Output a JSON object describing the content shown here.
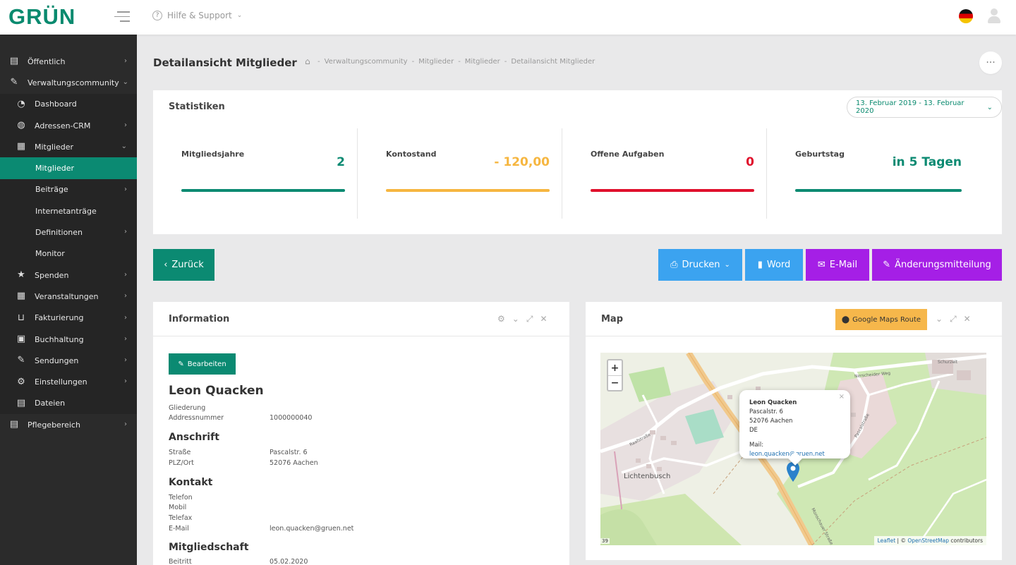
{
  "brand": {
    "logo": "GRÜN",
    "accent": "#0b8a72"
  },
  "topbar": {
    "help_label": "Hilfe & Support",
    "language": "de"
  },
  "sidebar": {
    "items": [
      {
        "label": "Öffentlich",
        "icon": "document-icon"
      },
      {
        "label": "Verwaltungscommunity",
        "icon": "pencil-icon"
      },
      {
        "label": "Dashboard",
        "icon": "dashboard-icon"
      },
      {
        "label": "Adressen-CRM",
        "icon": "globe-icon"
      },
      {
        "label": "Mitglieder",
        "icon": "members-icon"
      },
      {
        "label": "Mitglieder"
      },
      {
        "label": "Beiträge"
      },
      {
        "label": "Internetanträge"
      },
      {
        "label": "Definitionen"
      },
      {
        "label": "Monitor"
      },
      {
        "label": "Spenden",
        "icon": "star-icon"
      },
      {
        "label": "Veranstaltungen",
        "icon": "grid-icon"
      },
      {
        "label": "Fakturierung",
        "icon": "cart-icon"
      },
      {
        "label": "Buchhaltung",
        "icon": "ledger-icon"
      },
      {
        "label": "Sendungen",
        "icon": "pencil-icon"
      },
      {
        "label": "Einstellungen",
        "icon": "gear-icon"
      },
      {
        "label": "Dateien",
        "icon": "file-icon"
      },
      {
        "label": "Pflegebereich",
        "icon": "document-icon"
      }
    ]
  },
  "page": {
    "title": "Detailansicht Mitglieder",
    "breadcrumbs": [
      "Verwaltungscommunity",
      "Mitglieder",
      "Mitglieder",
      "Detailansicht Mitglieder"
    ]
  },
  "stats": {
    "title": "Statistiken",
    "date_range": "13. Februar 2019 - 13. Februar 2020",
    "items": [
      {
        "label": "Mitgliedsjahre",
        "value": "2",
        "color": "#0b8a72"
      },
      {
        "label": "Kontostand",
        "value": "- 120,00",
        "color": "#f6b640"
      },
      {
        "label": "Offene Aufgaben",
        "value": "0",
        "color": "#e0102c"
      },
      {
        "label": "Geburtstag",
        "value": "in 5 Tagen",
        "color": "#0b8a72"
      }
    ]
  },
  "actions": {
    "back": "Zurück",
    "print": "Drucken",
    "word": "Word",
    "email": "E-Mail",
    "change": "Änderungsmitteilung"
  },
  "info": {
    "title": "Information",
    "edit": "Bearbeiten",
    "name": "Leon Quacken",
    "gliederung_label": "Gliederung",
    "addressnr_label": "Addressnummer",
    "addressnr": "1000000040",
    "anschrift": "Anschrift",
    "strasse_label": "Straße",
    "strasse": "Pascalstr. 6",
    "plz_label": "PLZ/Ort",
    "plz": "52076 Aachen",
    "kontakt": "Kontakt",
    "telefon_label": "Telefon",
    "mobil_label": "Mobil",
    "telefax_label": "Telefax",
    "email_label": "E-Mail",
    "email": "leon.quacken@gruen.net",
    "mitgliedschaft": "Mitgliedschaft",
    "beitritt_label": "Beitritt",
    "beitritt": "05.02.2020"
  },
  "map": {
    "title": "Map",
    "route_button": "Google Maps Route",
    "popup": {
      "name": "Leon Quacken",
      "street": "Pascalstr. 6",
      "city": "52076 Aachen",
      "country": "DE",
      "mail_label": "Mail:",
      "mail": "leon.quacken@gruen.net"
    },
    "attribution_leaflet": "Leaflet",
    "attribution_sep": " | © ",
    "attribution_osm": "OpenStreetMap",
    "attribution_tail": " contributors",
    "place_label": "Lichtenbusch",
    "scale": "39",
    "road_labels": [
      "Nerscheider Weg",
      "Pascalstraße",
      "Monschauer Straße",
      "Raafstraße",
      "Schurzelt"
    ]
  }
}
